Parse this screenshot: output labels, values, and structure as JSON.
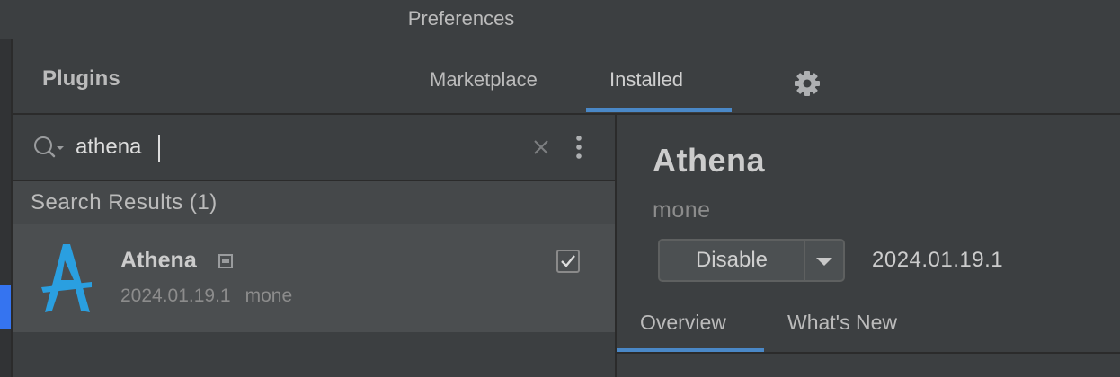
{
  "window": {
    "title": "Preferences"
  },
  "header": {
    "title": "Plugins",
    "tabs": [
      {
        "label": "Marketplace",
        "selected": false
      },
      {
        "label": "Installed",
        "selected": true
      }
    ],
    "settings_icon": "gear-icon"
  },
  "search": {
    "value": "athena",
    "placeholder": "",
    "search_icon": "search-icon",
    "clear_icon": "close-icon",
    "more_icon": "more-vertical-icon"
  },
  "results": {
    "label": "Search Results (1)",
    "items": [
      {
        "name": "Athena",
        "version": "2024.01.19.1",
        "vendor": "mone",
        "enabled": true,
        "logo_icon": "athena-logo-icon",
        "badge_icon": "bundled-badge-icon"
      }
    ]
  },
  "detail": {
    "name": "Athena",
    "vendor": "mone",
    "disable_label": "Disable",
    "version": "2024.01.19.1",
    "tabs": [
      {
        "label": "Overview",
        "selected": true
      },
      {
        "label": "What's New",
        "selected": false
      }
    ]
  },
  "colors": {
    "background": "#3c3f41",
    "accent": "#4a88c7",
    "selection": "#4b4e50",
    "logo": "#2a9fe0"
  }
}
